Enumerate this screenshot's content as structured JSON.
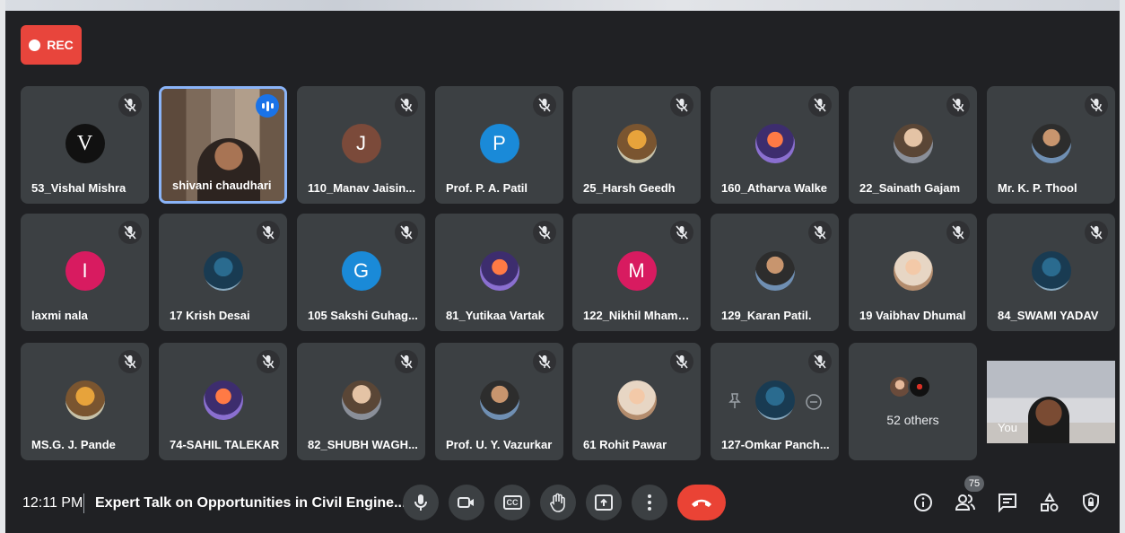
{
  "recording": {
    "label": "REC"
  },
  "tiles": [
    {
      "name": "53_Vishal Mishra",
      "avatar_type": "letter",
      "letter": "V",
      "color": "#111111"
    },
    {
      "name": "shivani chaudhari",
      "avatar_type": "video",
      "speaking": true
    },
    {
      "name": "110_Manav Jaisin...",
      "avatar_type": "letter",
      "letter": "J",
      "color": "#7b4a3a"
    },
    {
      "name": "Prof. P. A. Patil",
      "avatar_type": "letter",
      "letter": "P",
      "color": "#1a8ad8"
    },
    {
      "name": "25_Harsh Geedh",
      "avatar_type": "photo"
    },
    {
      "name": "160_Atharva Walke",
      "avatar_type": "photo"
    },
    {
      "name": "22_Sainath Gajam",
      "avatar_type": "photo"
    },
    {
      "name": "Mr. K. P. Thool",
      "avatar_type": "photo"
    },
    {
      "name": "laxmi nala",
      "avatar_type": "letter",
      "letter": "I",
      "color": "#d81b60"
    },
    {
      "name": "17 Krish Desai",
      "avatar_type": "photo"
    },
    {
      "name": "105 Sakshi Guhag...",
      "avatar_type": "letter",
      "letter": "G",
      "color": "#1a8ad8"
    },
    {
      "name": "81_Yutikaa Vartak",
      "avatar_type": "photo"
    },
    {
      "name": "122_Nikhil Mhamu...",
      "avatar_type": "letter",
      "letter": "M",
      "color": "#d81b60"
    },
    {
      "name": "129_Karan Patil.",
      "avatar_type": "photo"
    },
    {
      "name": "19 Vaibhav Dhumal",
      "avatar_type": "photo"
    },
    {
      "name": "84_SWAMI YADAV",
      "avatar_type": "photo"
    },
    {
      "name": "MS.G. J. Pande",
      "avatar_type": "photo"
    },
    {
      "name": "74-SAHIL TALEKAR",
      "avatar_type": "photo"
    },
    {
      "name": "82_SHUBH WAGH...",
      "avatar_type": "photo"
    },
    {
      "name": "Prof. U. Y. Vazurkar",
      "avatar_type": "photo"
    },
    {
      "name": "61 Rohit Pawar",
      "avatar_type": "photo"
    },
    {
      "name": "127-Omkar Panch...",
      "avatar_type": "photo",
      "hover_controls": true
    }
  ],
  "others_tile": {
    "label": "52 others"
  },
  "self_tile": {
    "label": "You"
  },
  "bottom_bar": {
    "time": "12:11 PM",
    "meeting_title": "Expert Talk on Opportunities in Civil Engine...",
    "cc_label": "CC",
    "participant_count": "75"
  }
}
